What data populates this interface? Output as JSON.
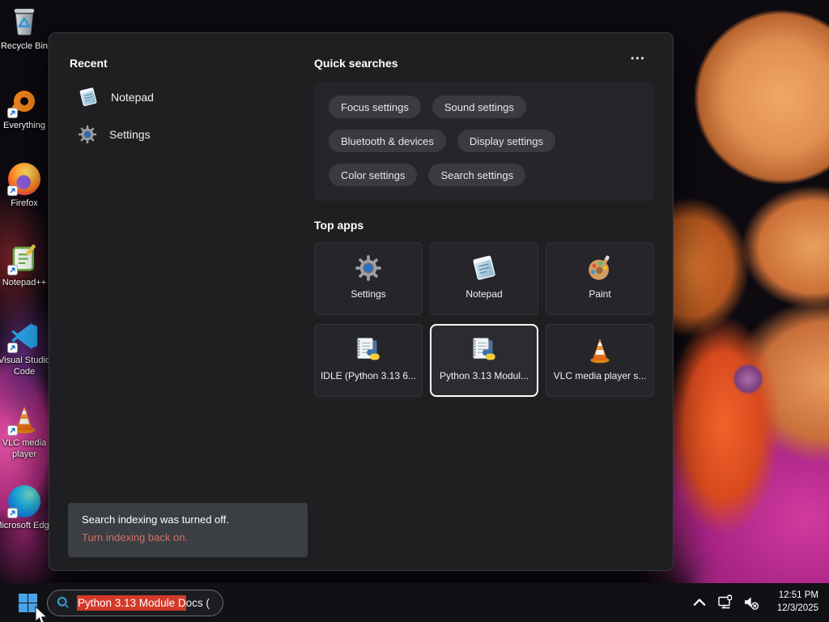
{
  "desktop": {
    "icons": [
      {
        "label": "Recycle Bin",
        "icon": "recycle-bin-icon"
      },
      {
        "label": "Everything",
        "icon": "everything-search-icon"
      },
      {
        "label": "Firefox",
        "icon": "firefox-icon"
      },
      {
        "label": "Notepad++",
        "icon": "notepad-plus-plus-icon"
      },
      {
        "label": "Visual Studio Code",
        "icon": "vscode-icon"
      },
      {
        "label": "VLC media player",
        "icon": "vlc-cone-icon"
      },
      {
        "label": "Microsoft Edge",
        "icon": "edge-icon"
      }
    ]
  },
  "search_panel": {
    "recent": {
      "header": "Recent",
      "items": [
        {
          "label": "Notepad",
          "icon": "notepad-icon"
        },
        {
          "label": "Settings",
          "icon": "settings-gear-icon"
        }
      ]
    },
    "quick_searches": {
      "header": "Quick searches",
      "more_label": "•••",
      "pills": [
        "Focus settings",
        "Sound settings",
        "Bluetooth & devices",
        "Display settings",
        "Color settings",
        "Search settings"
      ]
    },
    "top_apps": {
      "header": "Top apps",
      "tiles": [
        {
          "label": "Settings",
          "icon": "settings-gear-icon",
          "selected": false
        },
        {
          "label": "Notepad",
          "icon": "notepad-icon",
          "selected": false
        },
        {
          "label": "Paint",
          "icon": "paint-palette-icon",
          "selected": false
        },
        {
          "label": "IDLE (Python 3.13 6...",
          "icon": "python-doc-icon",
          "selected": false
        },
        {
          "label": "Python 3.13 Modul...",
          "icon": "python-doc-icon",
          "selected": true
        },
        {
          "label": "VLC media player s...",
          "icon": "vlc-cone-icon",
          "selected": false
        }
      ]
    },
    "notification": {
      "message": "Search indexing was turned off.",
      "link_label": "Turn indexing back on."
    }
  },
  "taskbar": {
    "search": {
      "selected_text": "Python 3.13 Module D",
      "rest_text": "ocs ("
    },
    "tray": {
      "time": "12:51 PM",
      "date": "12/3/2025"
    }
  },
  "colors": {
    "selection_red": "#d3392a",
    "link_red": "#cf7264",
    "accent_blue": "#4aa3e8",
    "panel_bg": "#1f1f22",
    "taskbar_bg": "#101114"
  }
}
